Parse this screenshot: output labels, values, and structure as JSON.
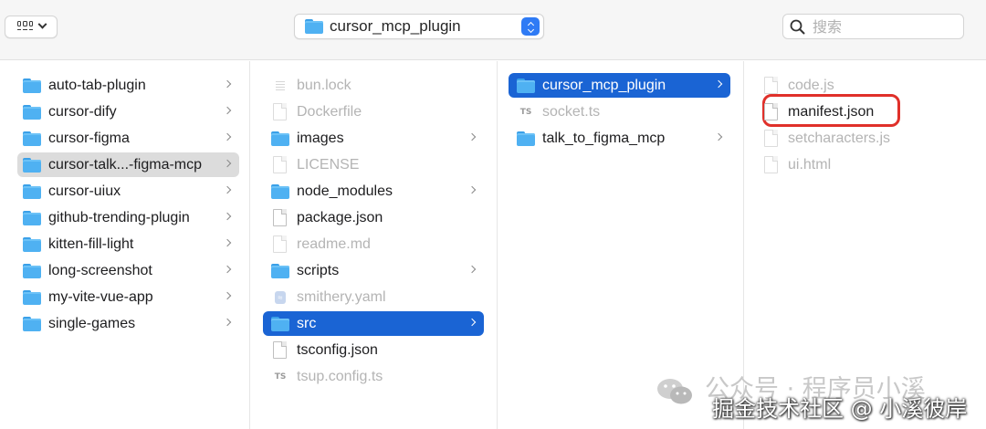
{
  "toolbar": {
    "view_icon": "icon-grid-view",
    "path_label": "cursor_mcp_plugin",
    "search_placeholder": "搜索"
  },
  "column1": [
    {
      "name": "auto-tab-plugin",
      "type": "folder",
      "selected": false
    },
    {
      "name": "cursor-dify",
      "type": "folder",
      "selected": false
    },
    {
      "name": "cursor-figma",
      "type": "folder",
      "selected": false
    },
    {
      "name": "cursor-talk...-figma-mcp",
      "type": "folder",
      "selected": "gray"
    },
    {
      "name": "cursor-uiux",
      "type": "folder",
      "selected": false
    },
    {
      "name": "github-trending-plugin",
      "type": "folder",
      "selected": false
    },
    {
      "name": "kitten-fill-light",
      "type": "folder",
      "selected": false
    },
    {
      "name": "long-screenshot",
      "type": "folder",
      "selected": false
    },
    {
      "name": "my-vite-vue-app",
      "type": "folder",
      "selected": false
    },
    {
      "name": "single-games",
      "type": "folder",
      "selected": false
    }
  ],
  "column2": [
    {
      "name": "bun.lock",
      "type": "file-lines",
      "dim": true
    },
    {
      "name": "Dockerfile",
      "type": "file",
      "dim": true
    },
    {
      "name": "images",
      "type": "folder",
      "dim": false
    },
    {
      "name": "LICENSE",
      "type": "file",
      "dim": true
    },
    {
      "name": "node_modules",
      "type": "folder",
      "dim": false
    },
    {
      "name": "package.json",
      "type": "file",
      "dim": false
    },
    {
      "name": "readme.md",
      "type": "file",
      "dim": true
    },
    {
      "name": "scripts",
      "type": "folder",
      "dim": false
    },
    {
      "name": "smithery.yaml",
      "type": "yaml",
      "dim": true
    },
    {
      "name": "src",
      "type": "folder",
      "dim": false,
      "selected": "blue"
    },
    {
      "name": "tsconfig.json",
      "type": "file",
      "dim": false
    },
    {
      "name": "tsup.config.ts",
      "type": "ts",
      "dim": true
    }
  ],
  "column3": [
    {
      "name": "cursor_mcp_plugin",
      "type": "folder",
      "dim": false,
      "selected": "blue"
    },
    {
      "name": "socket.ts",
      "type": "ts",
      "dim": true
    },
    {
      "name": "talk_to_figma_mcp",
      "type": "folder",
      "dim": false
    }
  ],
  "column4": [
    {
      "name": "code.js",
      "type": "file",
      "dim": true
    },
    {
      "name": "manifest.json",
      "type": "file",
      "dim": false,
      "highlighted": true
    },
    {
      "name": "setcharacters.js",
      "type": "file",
      "dim": true
    },
    {
      "name": "ui.html",
      "type": "file",
      "dim": true
    }
  ],
  "colors": {
    "selection_blue": "#1a64d4",
    "folder_blue": "#4fb1f2",
    "highlight_red": "#e0302a"
  },
  "watermark": {
    "line1": "公众号 · 程序员小溪",
    "line2": "掘金技术社区 @ 小溪彼岸",
    "icon": "wechat-icon"
  }
}
